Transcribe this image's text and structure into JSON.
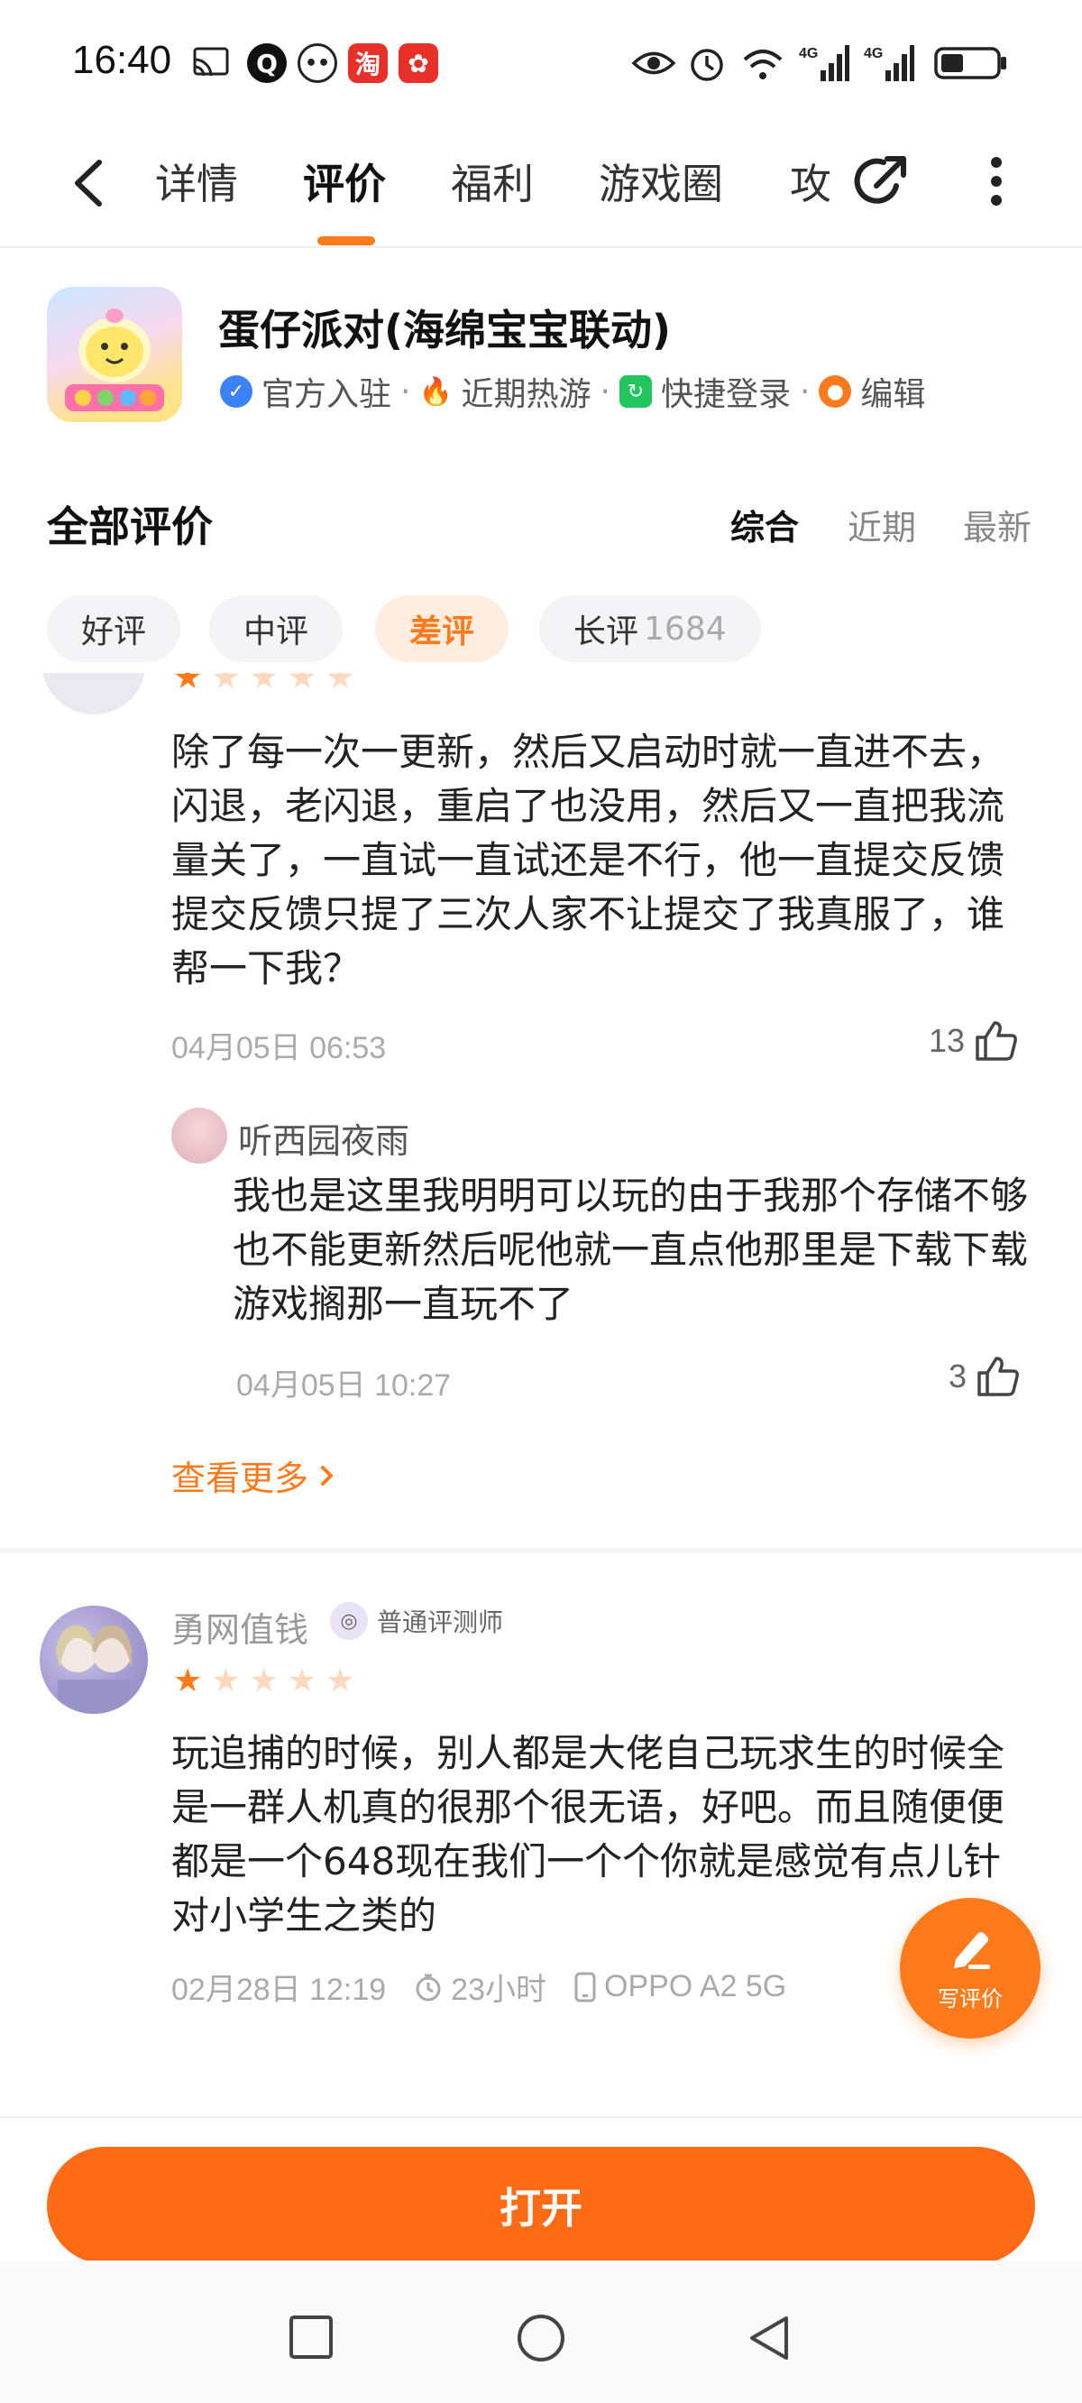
{
  "status_bar": {
    "time": "16:40",
    "network": "4G"
  },
  "nav": {
    "tabs": [
      {
        "label": "详情"
      },
      {
        "label": "评价"
      },
      {
        "label": "福利"
      },
      {
        "label": "游戏圈"
      },
      {
        "label": "攻"
      }
    ],
    "active_tab_index": 1
  },
  "game": {
    "title": "蛋仔派对(海绵宝宝联动)",
    "tags": [
      "官方入驻",
      "近期热游",
      "快捷登录",
      "编辑"
    ]
  },
  "reviews_section": {
    "title": "全部评价",
    "sort_options": [
      "综合",
      "近期",
      "最新"
    ],
    "filters": [
      {
        "label": "好评"
      },
      {
        "label": "中评"
      },
      {
        "label": "差评"
      },
      {
        "label": "长评",
        "count": "1684"
      }
    ]
  },
  "review1": {
    "rating": 1,
    "text": "除了每一次一更新，然后又启动时就一直进不去，闪退，老闪退，重启了也没用，然后又一直把我流量关了，一直试一直试还是不行，他一直提交反馈提交反馈只提了三次人家不让提交了我真服了，谁帮一下我？",
    "date": "04月05日 06:53",
    "likes": "13",
    "reply": {
      "user": "听西园夜雨",
      "text": "我也是这里我明明可以玩的由于我那个存储不够也不能更新然后呢他就一直点他那里是下载下载游戏搁那一直玩不了",
      "date": "04月05日 10:27",
      "likes": "3"
    },
    "see_more": "查看更多"
  },
  "review2": {
    "user": "勇网值钱",
    "badge": "普通评测师",
    "rating": 1,
    "text": "玩追捕的时候，别人都是大佬自己玩求生的时候全是一群人机真的很那个很无语，好吧。而且随便便都是一个648现在我们一个个你就是感觉有点儿针对小学生之类的",
    "date": "02月28日 12:19",
    "playtime": "23小时",
    "device": "OPPO A2 5G"
  },
  "fab": {
    "label": "写评价"
  },
  "bottom": {
    "open_label": "打开"
  },
  "colors": {
    "accent": "#ff7a1a",
    "button": "#ff6a14"
  }
}
